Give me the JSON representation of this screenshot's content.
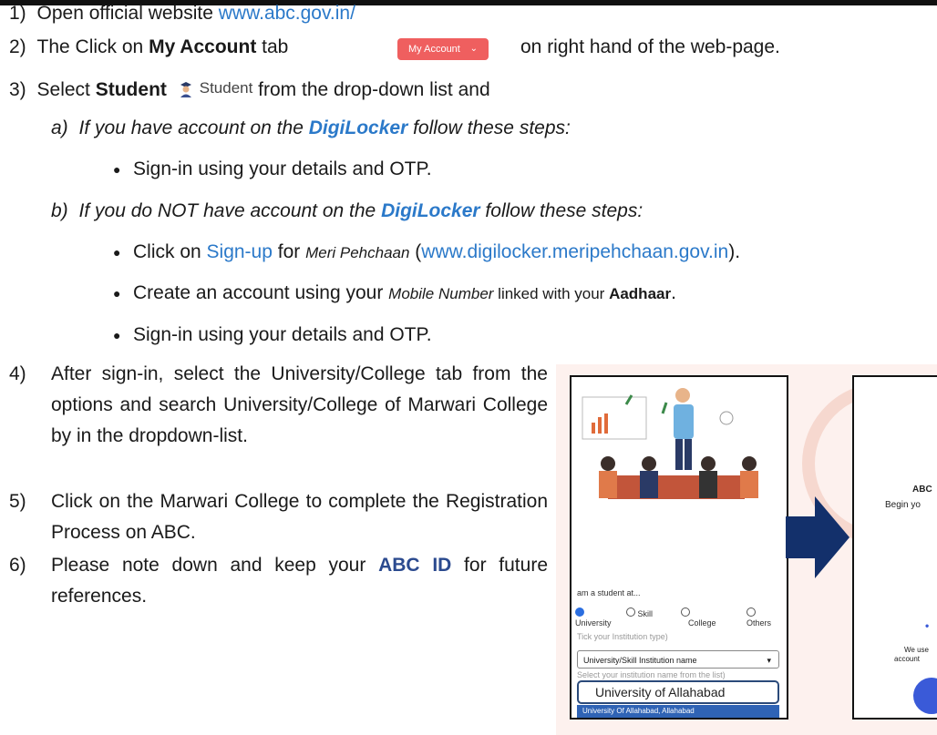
{
  "steps": {
    "s1": {
      "num": "1)",
      "text": "Open official website ",
      "link": "www.abc.gov.in/"
    },
    "s2": {
      "num": "2)",
      "pre": "The Click on ",
      "bold": "My Account",
      "mid": " tab",
      "button_label": "My Account",
      "post": "on right hand of the web-page."
    },
    "s3": {
      "num": "3)",
      "pre": "Select ",
      "bold": "Student",
      "icon_label": "Student",
      "post": " from the drop-down list and"
    },
    "s3a": {
      "letter": "a)",
      "pre": "If you have account on the ",
      "digi": "DigiLocker",
      "post": " follow these steps:"
    },
    "s3a_b1": "Sign-in using your details and OTP.",
    "s3b": {
      "letter": "b)",
      "pre": "If you do NOT have account on the ",
      "digi": "DigiLocker",
      "post": " follow these steps:"
    },
    "s3b_b1": {
      "pre": "Click on ",
      "link1": "Sign-up",
      "mid": " for ",
      "italic": "Meri Pehchaan",
      "open": " (",
      "link2": "www.digilocker.meripehchaan.gov.in",
      "close": ")."
    },
    "s3b_b2": {
      "pre": "Create an account using your ",
      "italic": "Mobile Number",
      "mid": " linked with your ",
      "bold": "Aadhaar",
      "end": "."
    },
    "s3b_b3": "Sign-in using your details and OTP.",
    "s4": {
      "num": "4)",
      "text": "After sign-in, select the University/College tab from the options and search University/College of Marwari College by in the dropdown-list."
    },
    "s5": {
      "num": "5)",
      "text": "Click on the Marwari College to complete the Registration Process on ABC."
    },
    "s6": {
      "num": "6)",
      "pre": "Please note down and keep your ",
      "bold": "ABC ID",
      "post": " for future references."
    }
  },
  "screenshot_left": {
    "caption": "am a student at...",
    "options": [
      "University",
      "Skill",
      "College",
      "Others"
    ],
    "hint": "Tick your Institution type)",
    "select_label": "University/Skill Institution name",
    "select_hint": "Select your institution name from the list)",
    "input_value": "University of Allahabad",
    "option_highlight": "University Of Allahabad, Allahabad"
  },
  "screenshot_right": {
    "line1": "ABC",
    "line2": "Begin yo",
    "line3": "We use",
    "line4": "account"
  },
  "colors": {
    "link": "#2b79c9",
    "button": "#ef5f5f",
    "arrow": "#13306b"
  }
}
